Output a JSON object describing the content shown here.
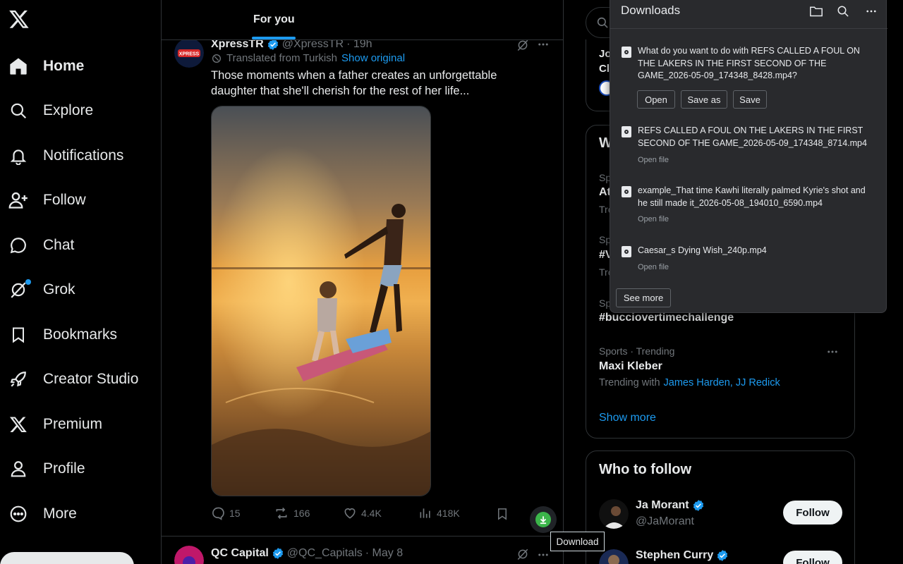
{
  "nav": {
    "home": "Home",
    "explore": "Explore",
    "notifications": "Notifications",
    "follow": "Follow",
    "chat": "Chat",
    "grok": "Grok",
    "bookmarks": "Bookmarks",
    "creator_studio": "Creator Studio",
    "premium": "Premium",
    "profile": "Profile",
    "more": "More"
  },
  "tabs": {
    "for_you": "For you"
  },
  "post1": {
    "author": "XpressTR",
    "handle": "@XpressTR",
    "time": "· 19h",
    "translated": "Translated from Turkish",
    "show_original": "Show original",
    "text": "Those moments when a father creates an unforgettable daughter that she'll cherish for the rest of her life...",
    "replies": "15",
    "reposts": "166",
    "likes": "4.4K",
    "views": "418K",
    "avatar_text": "XPRESS"
  },
  "post2": {
    "author": "QC Capital",
    "handle": "@QC_Capitals",
    "time": "· May 8"
  },
  "tooltip": "Download",
  "right": {
    "peek_line1": "Jo",
    "peek_line2": "Cl",
    "trend_card_title": "W",
    "peek_items": [
      {
        "meta": "Sp",
        "title": "At",
        "sub": "Tre"
      },
      {
        "meta": "Sp",
        "title": "#V",
        "sub": "Tre"
      },
      {
        "meta": "Sp",
        "title": "#bucciovertimechallenge"
      }
    ],
    "trend": {
      "meta": "Sports · Trending",
      "title": "Maxi Kleber",
      "with_label": "Trending with",
      "with_names": "James Harden, JJ Redick"
    },
    "show_more": "Show more",
    "who_to_follow": "Who to follow",
    "suggestions": [
      {
        "name": "Ja Morant",
        "handle": "@JaMorant",
        "button": "Follow"
      },
      {
        "name": "Stephen Curry",
        "handle": "",
        "button": "Follow"
      }
    ]
  },
  "downloads": {
    "title": "Downloads",
    "items": [
      {
        "name": "What do you want to do with REFS CALLED A FOUL ON THE LAKERS IN THE FIRST SECOND OF THE GAME_2026-05-09_174348_8428.mp4?",
        "open": "Open",
        "save_as": "Save as",
        "save": "Save"
      },
      {
        "name": "REFS CALLED A FOUL ON THE LAKERS IN THE FIRST SECOND OF THE GAME_2026-05-09_174348_8714.mp4",
        "sub": "Open file"
      },
      {
        "name": "example_That time Kawhi literally palmed Kyrie's shot and he still made it_2026-05-08_194010_6590.mp4",
        "sub": "Open file"
      },
      {
        "name": "Caesar_s Dying Wish_240p.mp4",
        "sub": "Open file"
      }
    ],
    "see_more": "See more"
  },
  "colors": {
    "accent": "#1d9bf0",
    "background": "#000000",
    "panel": "#292a2d",
    "download_green": "#3bb54a"
  },
  "icons": [
    "x-logo-icon",
    "home-icon",
    "search-icon",
    "bell-icon",
    "person-add-icon",
    "chat-icon",
    "grok-icon",
    "bookmark-icon",
    "rocket-icon",
    "premium-x-icon",
    "profile-icon",
    "more-circle-icon",
    "verified-badge-icon",
    "reply-icon",
    "repost-icon",
    "like-icon",
    "views-icon",
    "download-icon",
    "folder-icon",
    "ellipsis-icon",
    "file-video-icon"
  ]
}
